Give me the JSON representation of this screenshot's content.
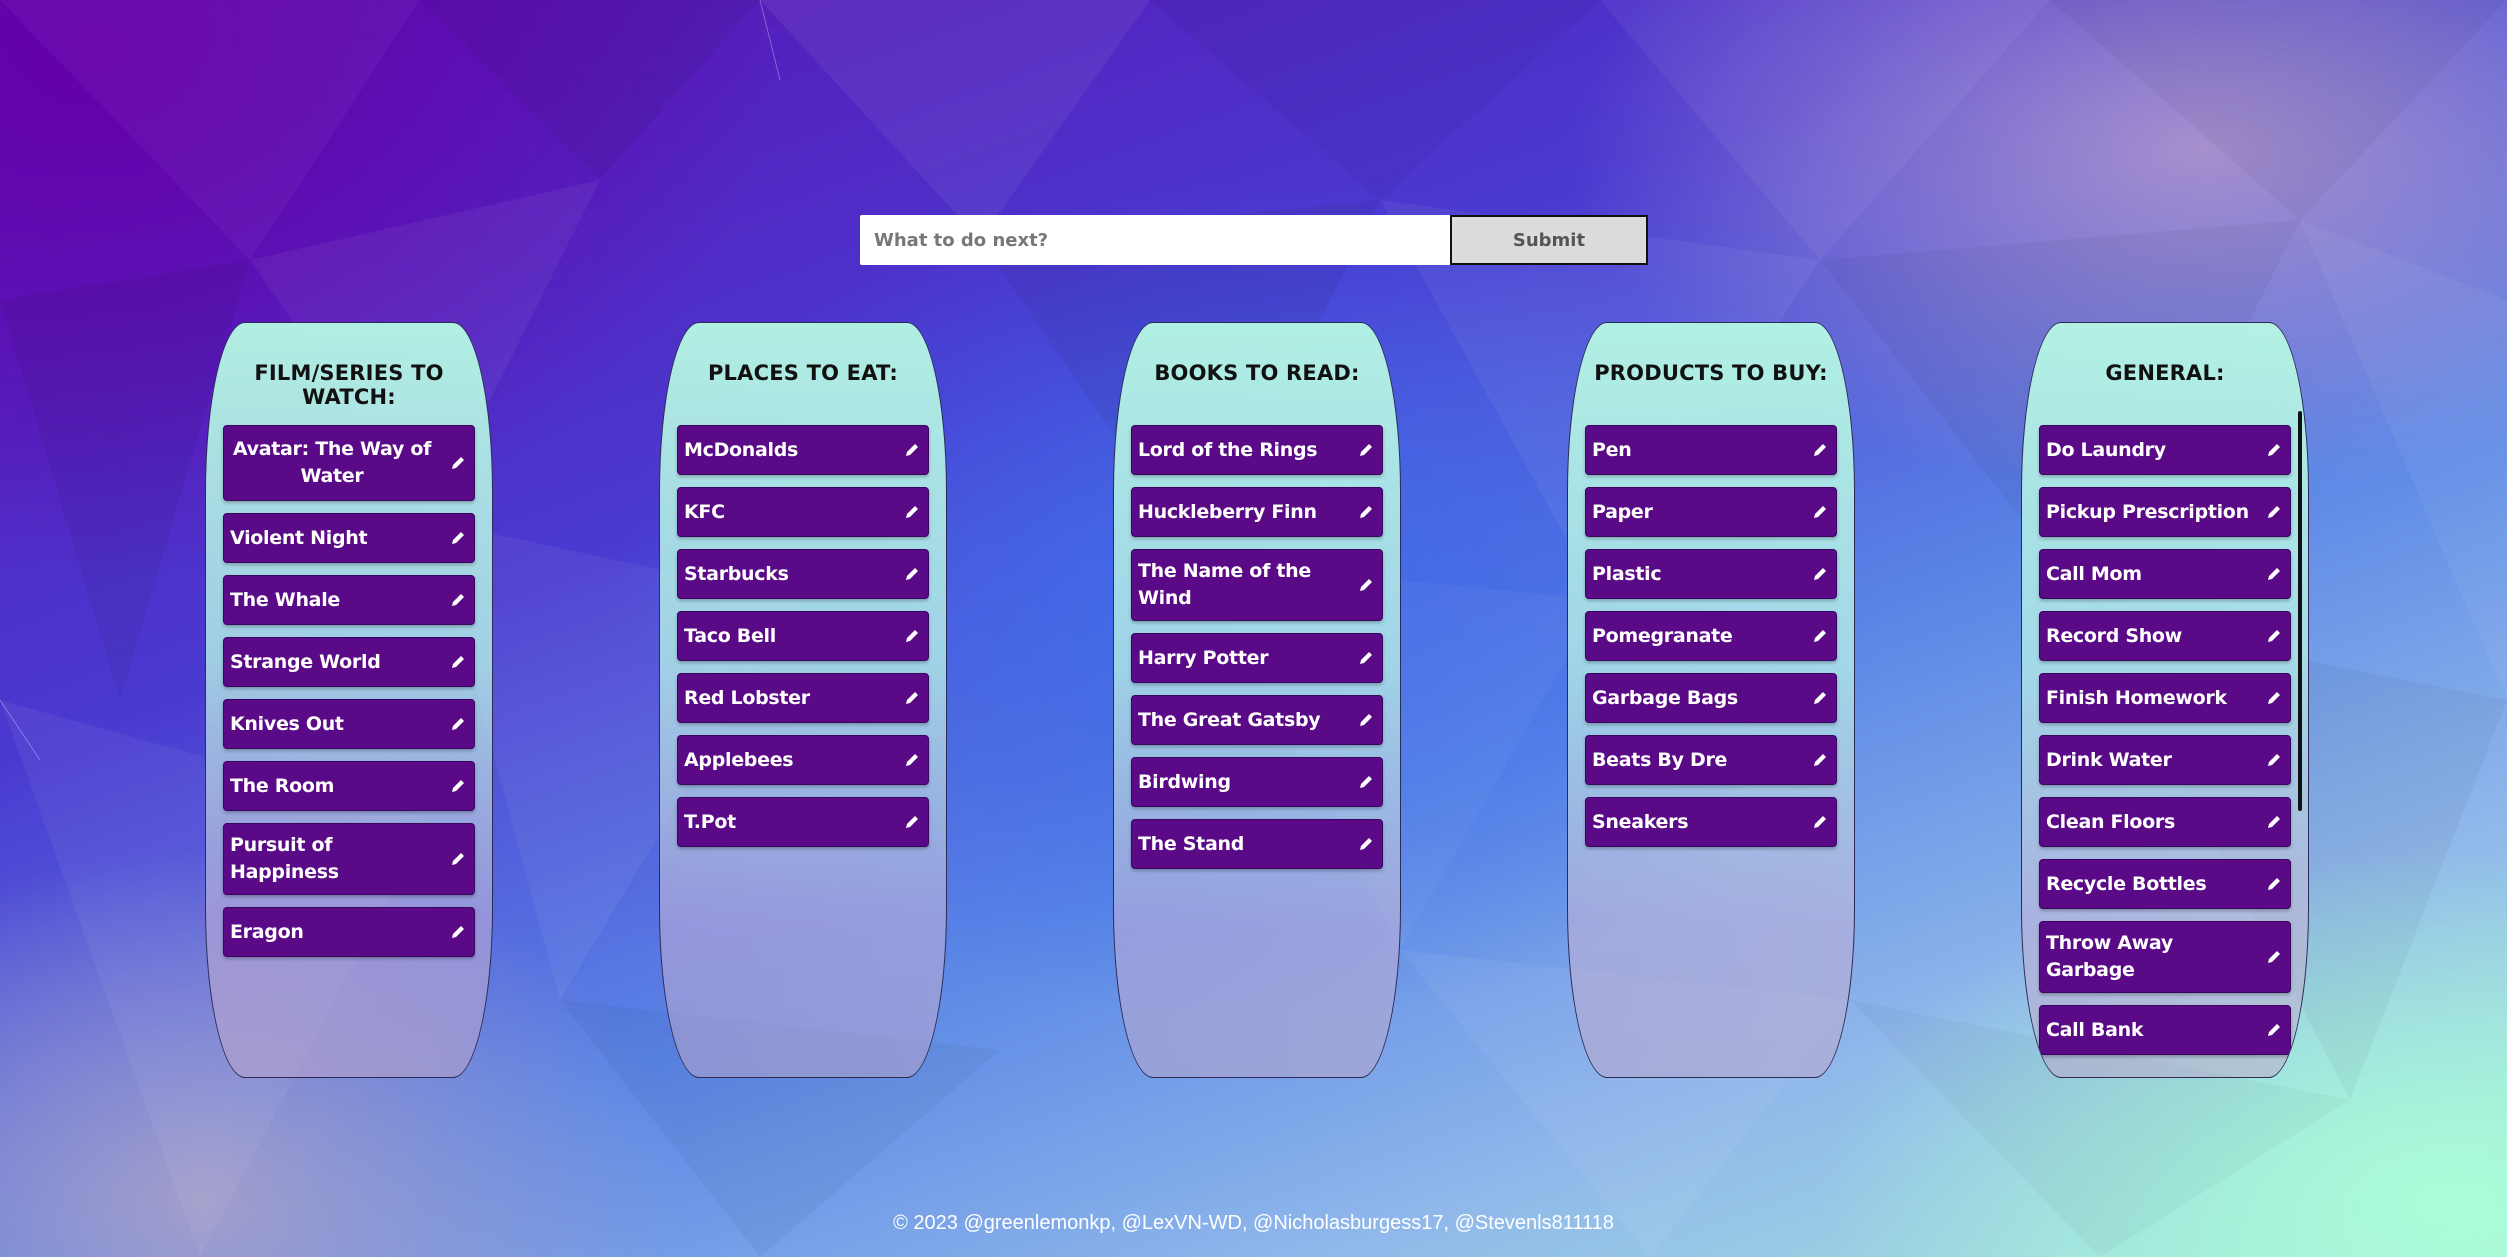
{
  "entry": {
    "placeholder": "What to do next?",
    "value": "",
    "submit_label": "Submit"
  },
  "lists": [
    {
      "title": "FILM/SERIES TO WATCH:",
      "items": [
        "Avatar: The Way of Water",
        "Violent Night",
        "The Whale",
        "Strange World",
        "Knives Out",
        "The Room",
        "Pursuit of Happiness",
        "Eragon"
      ]
    },
    {
      "title": "PLACES TO EAT:",
      "items": [
        "McDonalds",
        "KFC",
        "Starbucks",
        "Taco Bell",
        "Red Lobster",
        "Applebees",
        "T.Pot"
      ]
    },
    {
      "title": "BOOKS TO READ:",
      "items": [
        "Lord of the Rings",
        "Huckleberry Finn",
        "The Name of the Wind",
        "Harry Potter",
        "The Great Gatsby",
        "Birdwing",
        "The Stand"
      ]
    },
    {
      "title": "PRODUCTS TO BUY:",
      "items": [
        "Pen",
        "Paper",
        "Plastic",
        "Pomegranate",
        "Garbage Bags",
        "Beats By Dre",
        "Sneakers"
      ]
    },
    {
      "title": "GENERAL:",
      "items": [
        "Do Laundry",
        "Pickup Prescription",
        "Call Mom",
        "Record Show",
        "Finish Homework",
        "Drink Water",
        "Clean Floors",
        "Recycle Bottles",
        "Throw Away Garbage",
        "Call Bank"
      ]
    }
  ],
  "icons": {
    "item_action": "pencil-icon"
  },
  "colors": {
    "item_background": "#5a0a86",
    "panel_top": "#b4f5e4",
    "submit_background": "#dcdcdc"
  },
  "footer": {
    "text": "© 2023 @greenlemonkp, @LexVN-WD, @Nicholasburgess17, @Stevenls811118"
  }
}
